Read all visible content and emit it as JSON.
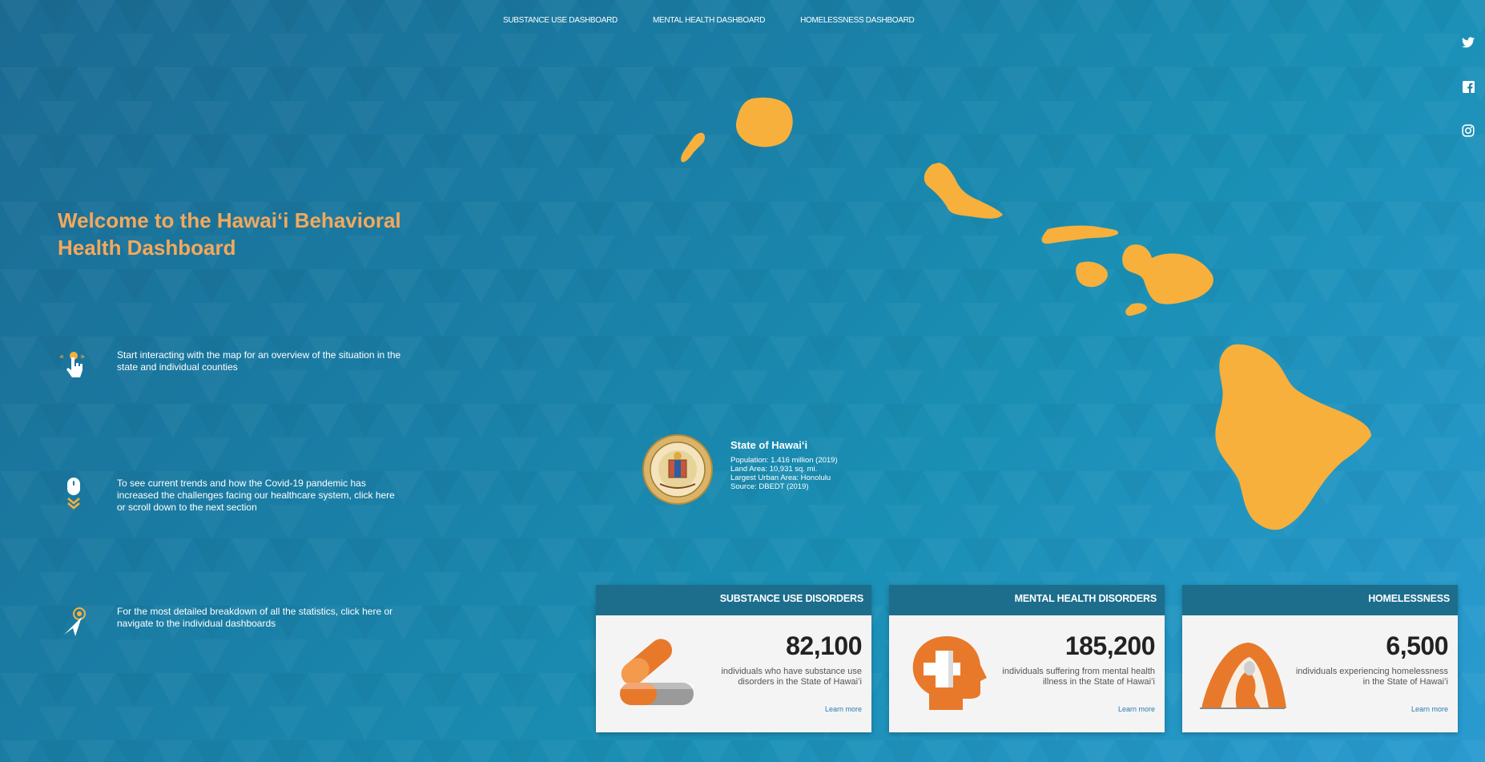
{
  "nav": {
    "substance": "SUBSTANCE USE DASHBOARD",
    "mental": "MENTAL HEALTH DASHBOARD",
    "homeless": "HOMELESSNESS DASHBOARD"
  },
  "social_icons": [
    "twitter-icon",
    "facebook-icon",
    "instagram-icon"
  ],
  "welcome_title": "Welcome to the Hawaiʻi Behavioral Health Dashboard",
  "steps": [
    {
      "icon": "tap-hand-icon",
      "text": "Start interacting with the map for an overview of the situation in the state and individual counties"
    },
    {
      "icon": "mouse-scroll-icon",
      "text": "To see current trends and how the Covid-19 pandemic has increased the challenges facing our healthcare system, click here or scroll down to the next section"
    },
    {
      "icon": "navigate-pointer-icon",
      "text": "For the most detailed breakdown of all the statistics, click here or navigate to the individual dashboards"
    }
  ],
  "state": {
    "title": "State of Hawaiʻi",
    "population": "Population: 1.416 million (2019)",
    "land_area": "Land Area: 10,931 sq. mi.",
    "urban_area": "Largest Urban Area: Honolulu",
    "source": "Source: DBEDT (2019)"
  },
  "cards": [
    {
      "header": "SUBSTANCE USE DISORDERS",
      "number": "82,100",
      "desc": "individuals who have substance use disorders in the State of Hawaiʻi",
      "link": "Learn more",
      "icon": "pills-icon"
    },
    {
      "header": "MENTAL HEALTH DISORDERS",
      "number": "185,200",
      "desc": "individuals suffering from mental health illness in the State of Hawaiʻi",
      "link": "Learn more",
      "icon": "head-cross-icon"
    },
    {
      "header": "HOMELESSNESS",
      "number": "6,500",
      "desc": "individuals experiencing homelessness in the State of Hawaiʻi",
      "link": "Learn more",
      "icon": "tent-person-icon"
    }
  ],
  "colors": {
    "accent": "#f5a85b",
    "island": "#f7b03c",
    "icon_orange": "#e8792b",
    "card_header": "#1c6e8c"
  }
}
